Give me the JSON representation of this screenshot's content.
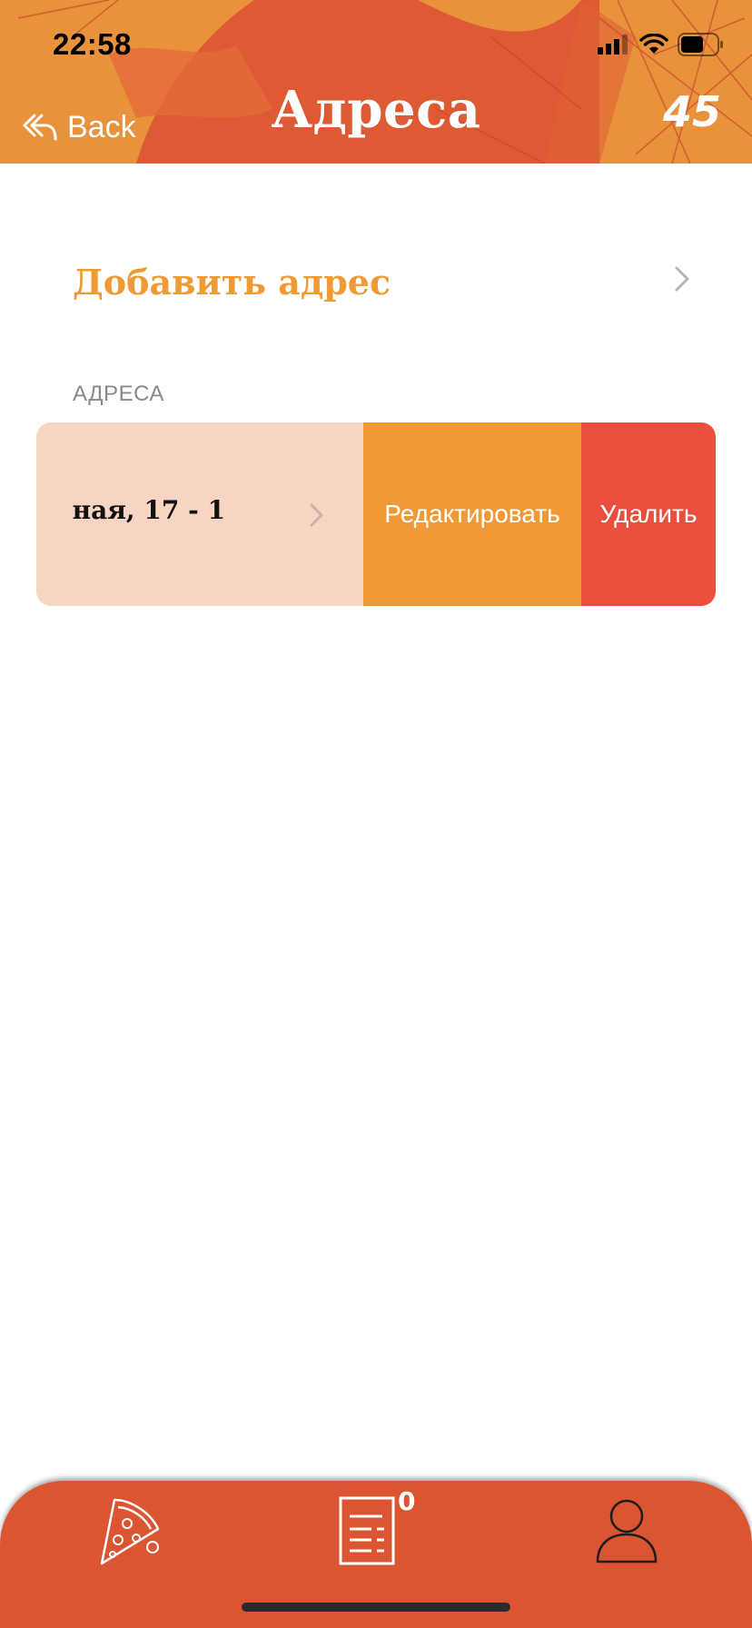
{
  "status_bar": {
    "time": "22:58"
  },
  "header": {
    "back_label": "Back",
    "title": "Адреса",
    "count": "45"
  },
  "add_address": {
    "label": "Добавить адрес"
  },
  "addresses_section": {
    "label": "АДРЕСА",
    "items": [
      {
        "address": "ная, 17 - 1",
        "actions": {
          "edit": "Редактировать",
          "delete": "Удалить"
        }
      }
    ]
  },
  "tab_bar": {
    "tabs": [
      "pizza-icon",
      "receipt-icon",
      "profile-icon"
    ],
    "orders_badge": "0"
  },
  "colors": {
    "header_bg": "#e9923c",
    "accent": "#ef9a35",
    "edit": "#f09a37",
    "delete": "#ea4e3d",
    "tabbar": "#dc5533",
    "card": "#f8d5c2"
  }
}
